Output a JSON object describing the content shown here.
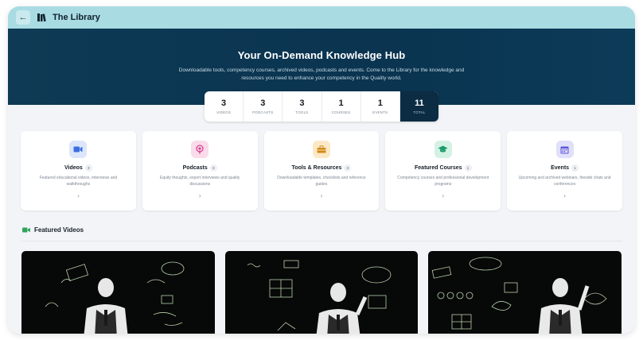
{
  "topbar": {
    "title": "The Library",
    "back_icon": "back-arrow-icon",
    "library_icon": "library-books-icon"
  },
  "hero": {
    "heading": "Your On-Demand Knowledge Hub",
    "subtext": "Downloadable tools, competency courses, archived videos, podcasts and events. Come to the Library for the knowledge and resources you need to enhance your competency in the Quality world."
  },
  "stats": [
    {
      "value": "3",
      "label": "VIDEOS"
    },
    {
      "value": "3",
      "label": "PODCASTS"
    },
    {
      "value": "3",
      "label": "TOOLS"
    },
    {
      "value": "1",
      "label": "COURSES"
    },
    {
      "value": "1",
      "label": "EVENTS"
    },
    {
      "value": "11",
      "label": "TOTAL"
    }
  ],
  "cards": [
    {
      "title": "Videos",
      "count": "3",
      "desc": "Featured educational videos, interviews and walkthroughs",
      "icon": "video-camera-icon",
      "icon_color": "#3b6fe0",
      "icon_bg": "#dbe6fb"
    },
    {
      "title": "Podcasts",
      "count": "3",
      "desc": "Equity thoughts, expert interviews and quality discussions",
      "icon": "podcast-icon",
      "icon_color": "#d5448f",
      "icon_bg": "#fadbe9"
    },
    {
      "title": "Tools & Resources",
      "count": "3",
      "desc": "Downloadable templates, checklists and reference guides",
      "icon": "toolbox-icon",
      "icon_color": "#d38a16",
      "icon_bg": "#fbe8c6"
    },
    {
      "title": "Featured Courses",
      "count": "1",
      "desc": "Competency courses and professional development programs",
      "icon": "graduation-cap-icon",
      "icon_color": "#1c9a6a",
      "icon_bg": "#d4f2e4"
    },
    {
      "title": "Events",
      "count": "1",
      "desc": "Upcoming and archived webinars, fireside chats and conferences",
      "icon": "calendar-icon",
      "icon_color": "#5a55d6",
      "icon_bg": "#e0e0fa"
    }
  ],
  "section": {
    "title": "Featured Videos",
    "icon": "video-section-icon",
    "accent": "#2fa55a"
  },
  "videos": [
    {
      "thumb": "video-thumbnail-1"
    },
    {
      "thumb": "video-thumbnail-2"
    },
    {
      "thumb": "video-thumbnail-3"
    }
  ]
}
